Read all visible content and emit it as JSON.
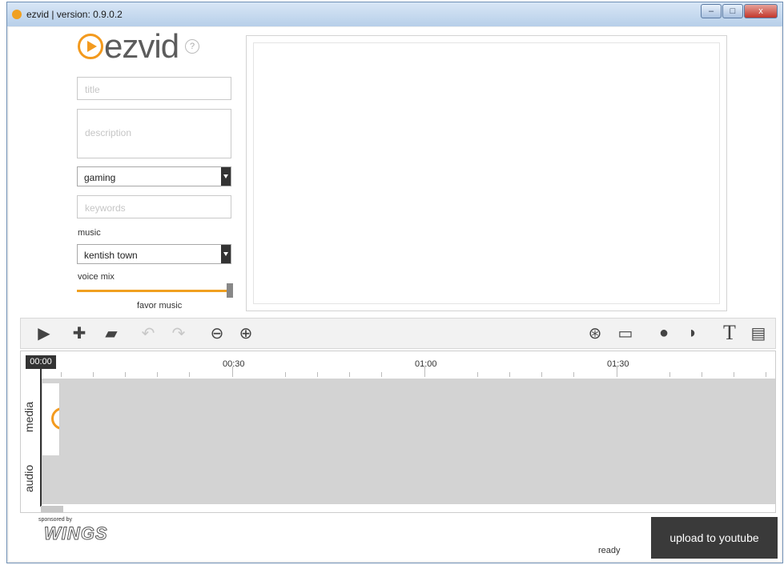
{
  "window": {
    "title": "ezvid | version: 0.9.0.2",
    "min": "–",
    "max": "□",
    "close": "x"
  },
  "logo": {
    "text": "ezvid",
    "help": "?"
  },
  "form": {
    "title_placeholder": "title",
    "description_placeholder": "description",
    "category": "gaming",
    "keywords_placeholder": "keywords",
    "music_label": "music",
    "music_value": "kentish town",
    "voice_mix_label": "voice mix",
    "voice_mix_caption": "favor music",
    "voice_mix_level": 1.0
  },
  "toolbar": {
    "icons": [
      "play-icon",
      "add-file-icon",
      "open-folder-icon",
      "undo-icon",
      "redo-icon",
      "zoom-out-icon",
      "zoom-in-icon",
      "gamepad-icon",
      "monitor-icon",
      "microphone-icon",
      "speech-icon",
      "text-icon",
      "filmstrip-icon"
    ],
    "glyphs": {
      "play": "▶",
      "add": "✚",
      "open": "▰",
      "undo": "↶",
      "redo": "↷",
      "zoom_out": "⊖",
      "zoom_in": "⊕",
      "gamepad": "⊛",
      "monitor": "▭",
      "mic": "●",
      "speech": "◗",
      "text": "T",
      "film": "▤"
    }
  },
  "timeline": {
    "playhead": "00:00",
    "time_labels": [
      "00:30",
      "01:00",
      "01:30"
    ],
    "tracks": [
      "media",
      "audio"
    ]
  },
  "footer": {
    "sponsored_by": "sponsored by",
    "sponsor_logo": "WINGS",
    "status": "ready",
    "upload_label": "upload to youtube"
  },
  "colors": {
    "accent": "#f39a1e",
    "upload_bg": "#3a3a3a"
  }
}
